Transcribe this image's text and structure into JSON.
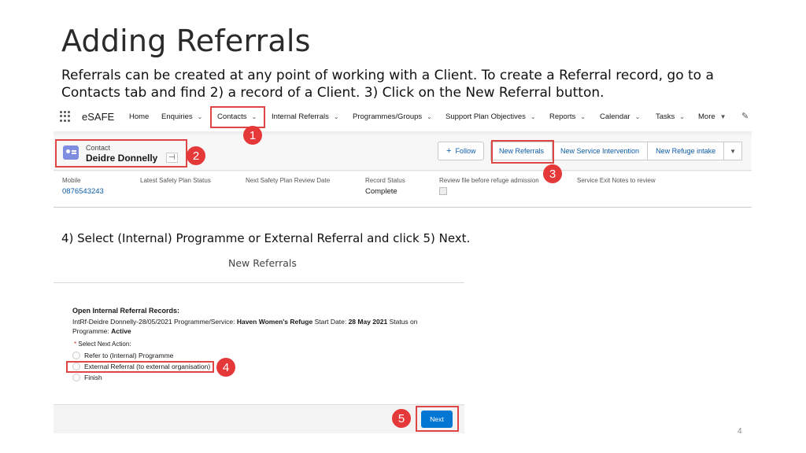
{
  "slide": {
    "title": "Adding Referrals",
    "intro": "Referrals can be created at any point of working with a Client. To create a Referral record, go to a Contacts tab and find 2) a record of a Client. 3) Click on the New Referral button.",
    "step_text": "4) Select (Internal) Programme or External Referral and click 5) Next.",
    "page_number": "4"
  },
  "navbar": {
    "app_name": "eSAFE",
    "items": [
      {
        "label": "Home",
        "dropdown": false
      },
      {
        "label": "Enquiries",
        "dropdown": true
      },
      {
        "label": "Contacts",
        "dropdown": true,
        "active": true
      },
      {
        "label": "Internal Referrals",
        "dropdown": true
      },
      {
        "label": "Programmes/Groups",
        "dropdown": true
      },
      {
        "label": "Support Plan Objectives",
        "dropdown": true
      },
      {
        "label": "Reports",
        "dropdown": true
      },
      {
        "label": "Calendar",
        "dropdown": true
      },
      {
        "label": "Tasks",
        "dropdown": true
      },
      {
        "label": "More",
        "dropdown": true
      }
    ]
  },
  "record": {
    "type": "Contact",
    "name": "Deidre Donnelly",
    "actions": {
      "follow": "Follow",
      "new_referrals": "New Referrals",
      "new_service_intervention": "New Service Intervention",
      "new_refuge_intake": "New Refuge intake"
    },
    "fields": [
      {
        "label": "Mobile",
        "value": "0876543243"
      },
      {
        "label": "Latest Safety Plan Status",
        "value": ""
      },
      {
        "label": "Next Safety Plan Review Date",
        "value": ""
      },
      {
        "label": "Record Status",
        "value": "Complete"
      },
      {
        "label": "Review file before refuge admission",
        "value": ""
      },
      {
        "label": "Service Exit Notes to review",
        "value": ""
      }
    ]
  },
  "modal": {
    "title": "New Referrals",
    "open_heading": "Open Internal Referral Records:",
    "record_line": {
      "prefix": "IntRf-Deidre Donnelly-28/05/2021 Programme/Service:",
      "service": "Haven Women's Refuge",
      "start_label": "Start Date:",
      "start_date": "28 May 2021",
      "status_label": "Status on Programme:",
      "status": "Active"
    },
    "action_label": "Select Next Action:",
    "options": [
      "Refer to (Internal) Programme",
      "External Referral (to external organisation)",
      "Finish"
    ],
    "next_button": "Next"
  },
  "annotations": [
    "1",
    "2",
    "3",
    "4",
    "5"
  ],
  "colors": {
    "annotation_red": "#e53939",
    "link_blue": "#0b5cab",
    "next_button_blue": "#0176d3",
    "record_icon": "#7f8de1"
  }
}
